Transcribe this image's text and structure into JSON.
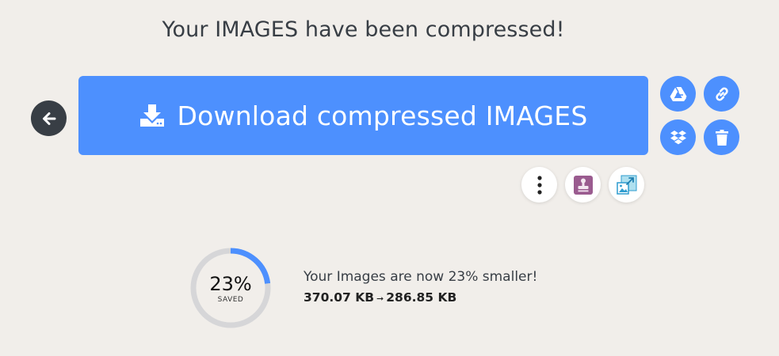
{
  "header": {
    "title": "Your IMAGES have been compressed!"
  },
  "actions": {
    "download_label": "Download compressed IMAGES",
    "back_icon": "arrow-left-icon",
    "side_buttons": [
      {
        "name": "google-drive-icon"
      },
      {
        "name": "link-icon"
      },
      {
        "name": "dropbox-icon"
      },
      {
        "name": "trash-icon"
      }
    ],
    "more_buttons": [
      {
        "name": "more-vertical-icon"
      },
      {
        "name": "stamp-icon"
      },
      {
        "name": "resize-image-icon"
      }
    ]
  },
  "result": {
    "percent_label": "23%",
    "percent_value": 23,
    "saved_label": "SAVED",
    "summary": "Your Images are now 23% smaller!",
    "original_size": "370.07 KB",
    "arrow": "➞",
    "new_size": "286.85 KB"
  },
  "colors": {
    "accent": "#4d90fe",
    "dark": "#383e45",
    "background": "#f1eeea",
    "ring_track": "#d6d6d8"
  }
}
